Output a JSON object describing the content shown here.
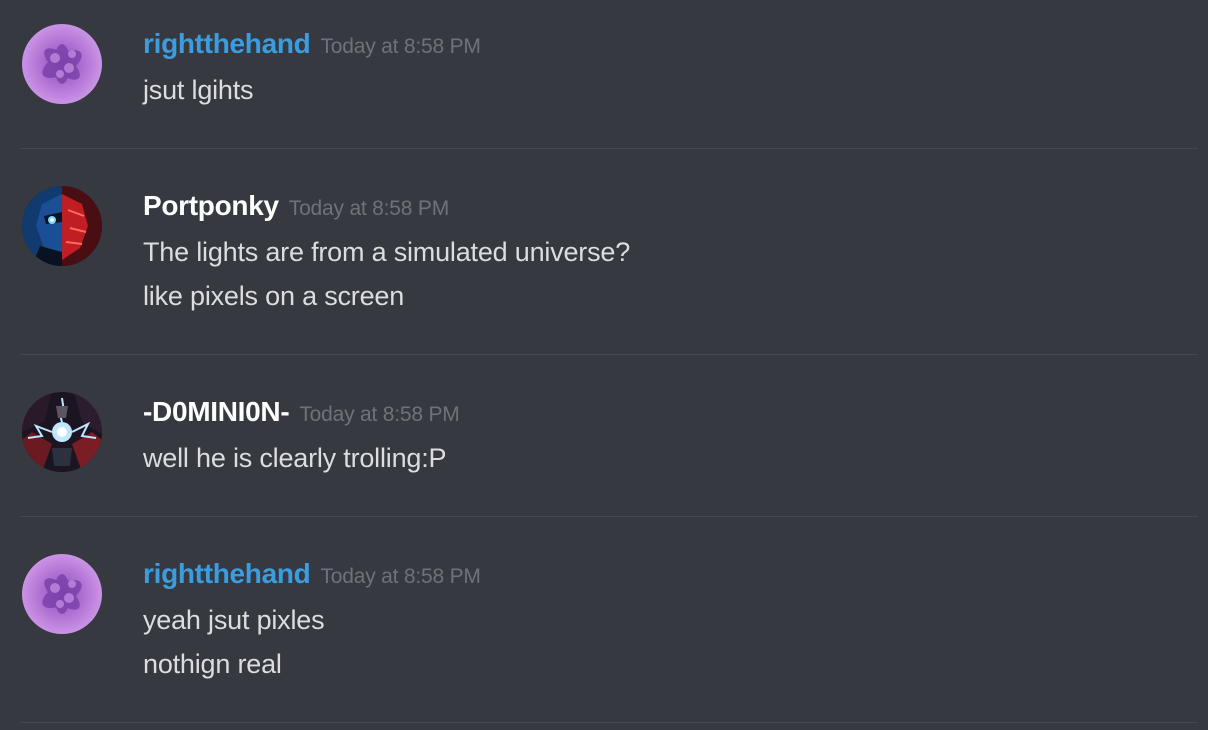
{
  "colors": {
    "background": "#36393f",
    "username_blue": "#3b9de0",
    "username_white": "#ffffff",
    "timestamp": "#6f7278",
    "message_text": "#dcddde",
    "divider": "#44474d"
  },
  "messages": [
    {
      "username": "rightthehand",
      "username_color": "#3b9de0",
      "timestamp": "Today at 8:58 PM",
      "avatar": "purple-flower-avatar",
      "lines": [
        "jsut lgihts"
      ]
    },
    {
      "username": "Portponky",
      "username_color": "#ffffff",
      "timestamp": "Today at 8:58 PM",
      "avatar": "blue-red-face-avatar",
      "lines": [
        "The lights are from a simulated universe?",
        "like pixels on a screen"
      ]
    },
    {
      "username": "-D0MINI0N-",
      "username_color": "#ffffff",
      "timestamp": "Today at 8:58 PM",
      "avatar": "lightning-hero-avatar",
      "lines": [
        "well he is clearly trolling:P"
      ]
    },
    {
      "username": "rightthehand",
      "username_color": "#3b9de0",
      "timestamp": "Today at 8:58 PM",
      "avatar": "purple-flower-avatar",
      "lines": [
        "yeah jsut pixles",
        "nothign real"
      ]
    }
  ]
}
